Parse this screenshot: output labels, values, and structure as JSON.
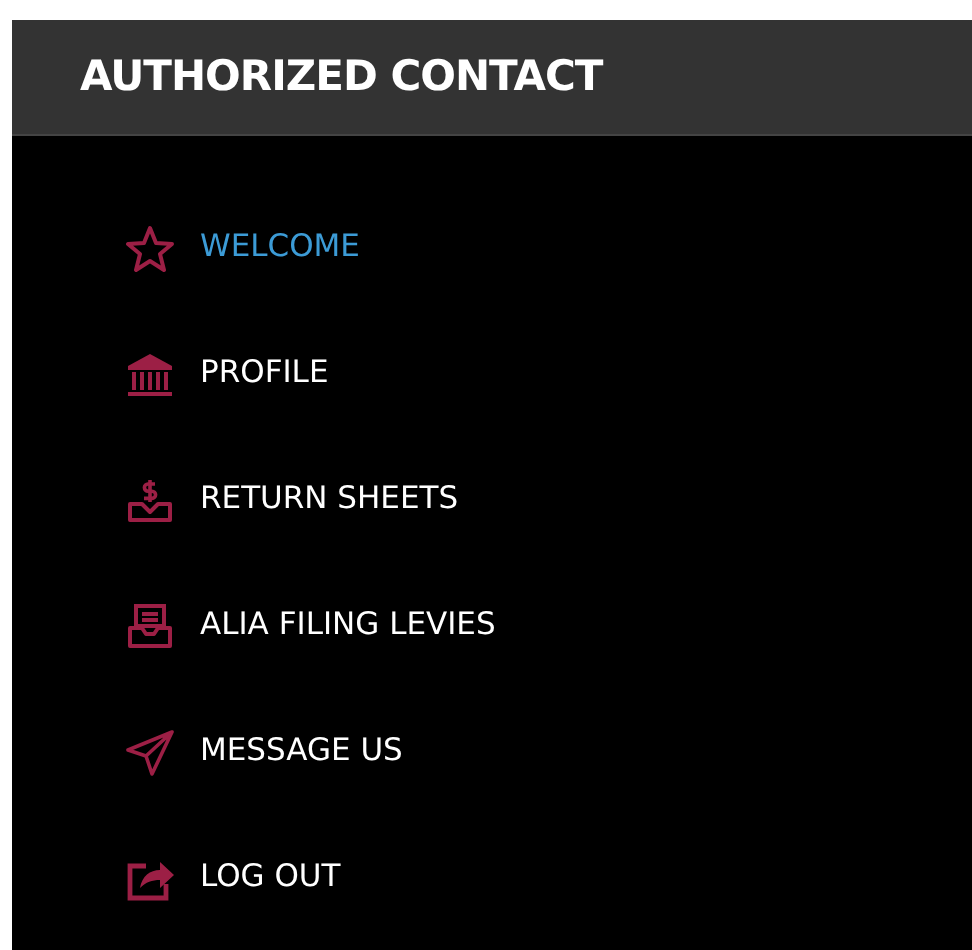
{
  "sidebar": {
    "title": "AUTHORIZED CONTACT",
    "items": [
      {
        "label": "WELCOME",
        "selected": true
      },
      {
        "label": "PROFILE",
        "selected": false
      },
      {
        "label": "RETURN SHEETS",
        "selected": false
      },
      {
        "label": "ALIA FILING LEVIES",
        "selected": false
      },
      {
        "label": "MESSAGE US",
        "selected": false
      },
      {
        "label": "LOG OUT",
        "selected": false
      }
    ]
  }
}
